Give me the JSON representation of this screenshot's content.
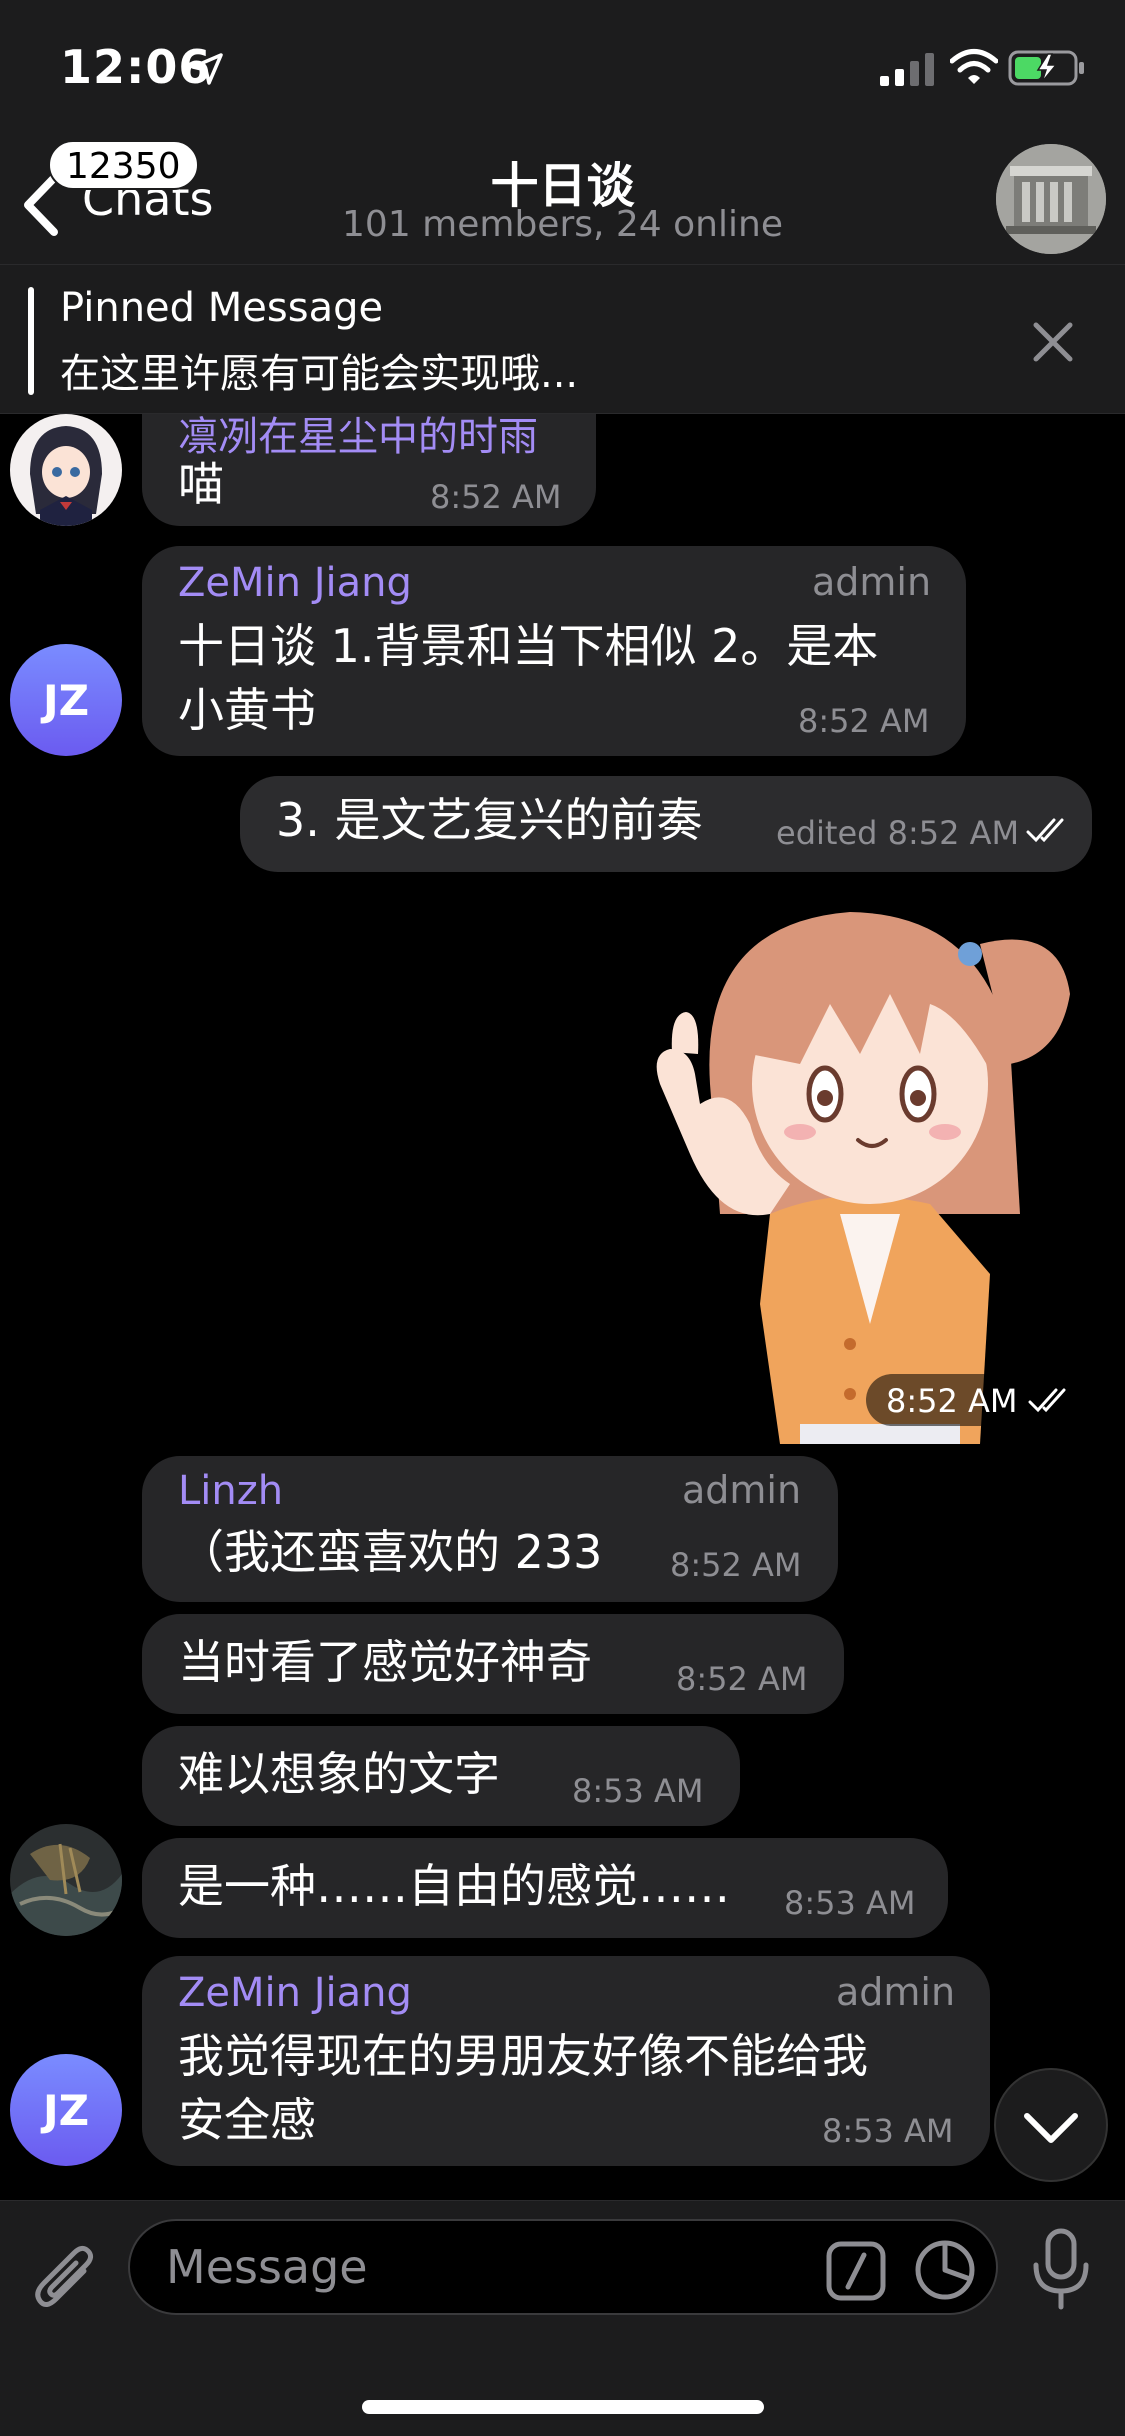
{
  "status_bar": {
    "time": "12:06"
  },
  "nav": {
    "back_label": "Chats",
    "unread_count": "12350",
    "title": "十日谈",
    "subtitle": "101 members, 24 online"
  },
  "pinned": {
    "title": "Pinned Message",
    "text": "在这里许愿有可能会实现哦..."
  },
  "messages": [
    {
      "id": "m1",
      "sender": "凛冽在星尘中的时雨",
      "text": "喵",
      "time": "8:52 AM"
    },
    {
      "id": "m2",
      "sender": "ZeMin Jiang",
      "role": "admin",
      "lines": [
        "十日谈 1.背景和当下相似 2。是本",
        "小黄书"
      ],
      "time": "8:52 AM",
      "avatar": "JZ"
    },
    {
      "id": "m3",
      "outgoing": true,
      "text": "3. 是文艺复兴的前奏",
      "time": "edited 8:52 AM"
    },
    {
      "id": "m4",
      "outgoing": true,
      "sticker": "thumbs-up-anime-girl",
      "time": "8:52 AM"
    },
    {
      "id": "m5",
      "sender": "Linzh",
      "role": "admin",
      "text": "（我还蛮喜欢的 233",
      "time": "8:52 AM"
    },
    {
      "id": "m6",
      "text": "当时看了感觉好神奇",
      "time": "8:52 AM"
    },
    {
      "id": "m7",
      "text": "难以想象的文字",
      "time": "8:53 AM"
    },
    {
      "id": "m8",
      "text": "是一种……自由的感觉……",
      "time": "8:53 AM"
    },
    {
      "id": "m9",
      "sender": "ZeMin Jiang",
      "role": "admin",
      "lines": [
        "我觉得现在的男朋友好像不能给我",
        "安全感"
      ],
      "time": "8:53 AM",
      "avatar": "JZ"
    }
  ],
  "input": {
    "placeholder": "Message"
  },
  "colors": {
    "accent_name": "#a38cf5",
    "bubble": "#262628",
    "bar": "#1c1c1d"
  }
}
